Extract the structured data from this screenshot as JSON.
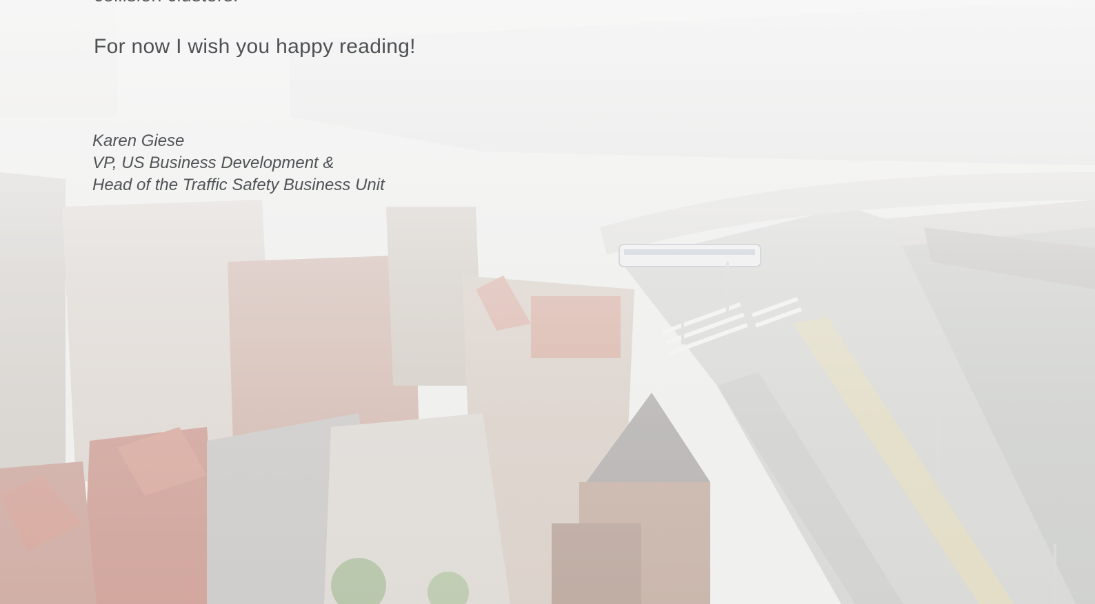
{
  "letter": {
    "cut_line": "collision clusters.",
    "closing": "For now I wish you happy reading!"
  },
  "signature": {
    "name": "Karen Giese",
    "title_line_1": "VP, US Business Development &",
    "title_line_2": "Head of the Traffic Safety Business Unit"
  },
  "background": {
    "description_icon": "city-aerial-photo",
    "sky_color": "#f3f3f2",
    "water_color": "#b9bbb7",
    "roof_red": "#c98a7c",
    "brick": "#b89a8a"
  }
}
